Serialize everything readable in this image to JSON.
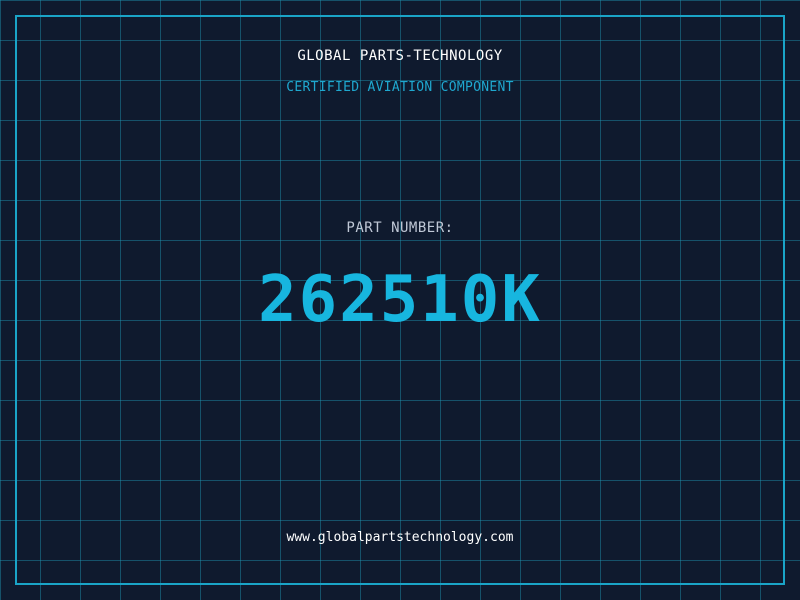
{
  "header": {
    "company": "GLOBAL PARTS-TECHNOLOGY",
    "subtitle": "CERTIFIED AVIATION COMPONENT"
  },
  "part": {
    "label": "PART NUMBER:",
    "number": "262510K"
  },
  "footer": {
    "website": "www.globalpartstechnology.com"
  },
  "colors": {
    "background": "#0f1a2e",
    "grid": "#2096b4",
    "accent": "#17b6df",
    "label": "#c0c8d6",
    "text": "#ffffff"
  }
}
